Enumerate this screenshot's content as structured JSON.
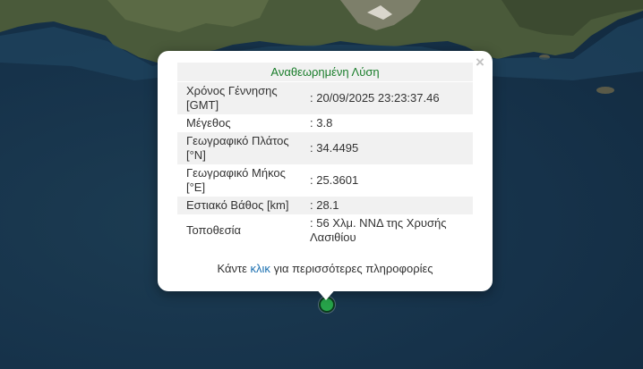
{
  "popup": {
    "title": "Αναθεωρημένη Λύση",
    "close_symbol": "×",
    "rows": [
      {
        "label": "Χρόνος Γέννησης [GMT]",
        "value": ": 20/09/2025 23:23:37.46"
      },
      {
        "label": "Μέγεθος",
        "value": ": 3.8"
      },
      {
        "label": "Γεωγραφικό Πλάτος [°N]",
        "value": ": 34.4495"
      },
      {
        "label": "Γεωγραφικό Μήκος [°E]",
        "value": ": 25.3601"
      },
      {
        "label": "Εστιακό Βάθος [km]",
        "value": ": 28.1"
      },
      {
        "label": "Τοποθεσία",
        "value": ": 56 Χλμ. ΝΝΔ της Χρυσής Λασιθίου"
      }
    ],
    "more_prefix": "Κάντε",
    "more_link": "κλικ",
    "more_suffix": "για περισσότερες πληροφορίες"
  },
  "marker": {
    "color": "#27a34a",
    "icon": "earthquake-marker-icon"
  },
  "colors": {
    "title": "#1a7d2b",
    "link": "#1a6fb0",
    "sea": "#16324a"
  }
}
